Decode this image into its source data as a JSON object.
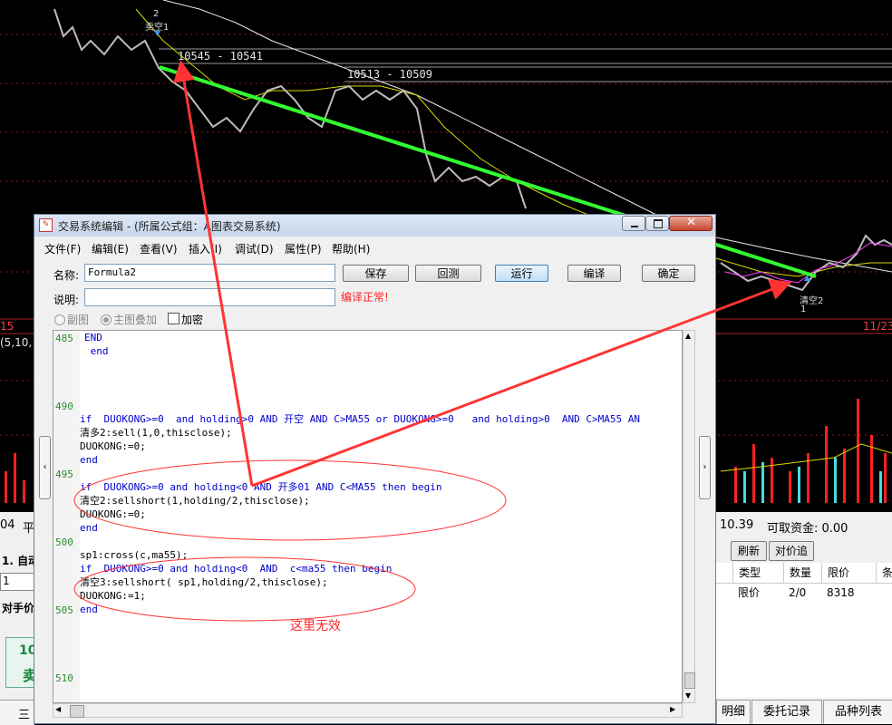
{
  "chart": {
    "price_labels": [
      "10545 - 10541",
      "10513 - 10509"
    ],
    "marker_top": "卖空1",
    "marker_top_num": "2",
    "marker_bottom": "清空2",
    "marker_bottom_num": "1",
    "date_left": "15",
    "date_right": "11/23",
    "ma_label": "(5,10,"
  },
  "window": {
    "title": "交易系统编辑 - (所属公式组：A图表交易系统)",
    "menu": [
      "文件(F)",
      "编辑(E)",
      "查看(V)",
      "插入(I)",
      "调试(D)",
      "属性(P)",
      "帮助(H)"
    ],
    "name_label": "名称:",
    "name_value": "Formula2",
    "desc_label": "说明:",
    "desc_value": "",
    "buttons": [
      "保存",
      "回测",
      "运行",
      "编译",
      "确定"
    ],
    "compile_status": "编译正常!",
    "options": [
      "副图",
      "主图叠加",
      "加密"
    ]
  },
  "code": {
    "line_numbers": [
      "485",
      "490",
      "495",
      "500",
      "505",
      "510"
    ],
    "lines": [
      "END",
      " end",
      "",
      "",
      "",
      "if  DUOKONG>=0  and holding>0 AND 开空 AND C>MA55 or DUOKONG>=0   and holding>0  AND C>MA55 AN",
      "清多2:sell(1,0,thisclose);",
      "DUOKONG:=0;",
      "end",
      "",
      "if  DUOKONG>=0 and holding<0 AND 开多01 AND C<MA55 then begin",
      "清空2:sellshort(1,holding/2,thisclose);",
      "DUOKONG:=0;",
      "end",
      "",
      "sp1:cross(c,ma55);",
      "if  DUOKONG>=0 and holding<0  AND  c<ma55 then begin",
      "清空3:sellshort( sp1,holding/2,thisclose);",
      "DUOKONG:=1;",
      "end"
    ]
  },
  "annotation": {
    "note": "这里无效"
  },
  "trade_panel": {
    "balance_fragment": "10.39",
    "available_label": "可取资金: 0.00",
    "refresh_button": "刷新",
    "chase_button": "对价追",
    "table_headers": [
      "类型",
      "数量",
      "限价",
      "条"
    ],
    "table_row": [
      "限价",
      "2/0",
      "8318"
    ],
    "tabs": [
      "明细",
      "委托记录",
      "品种列表"
    ],
    "left_fragments": [
      "04",
      "平",
      "1. 自动",
      "1",
      "对手价",
      "10",
      "卖",
      "三"
    ]
  },
  "colors": {
    "trend_line": "#33ff33",
    "annotation": "#ff3333",
    "code_keyword": "#0000cc",
    "line_number": "#2d8a2d"
  }
}
